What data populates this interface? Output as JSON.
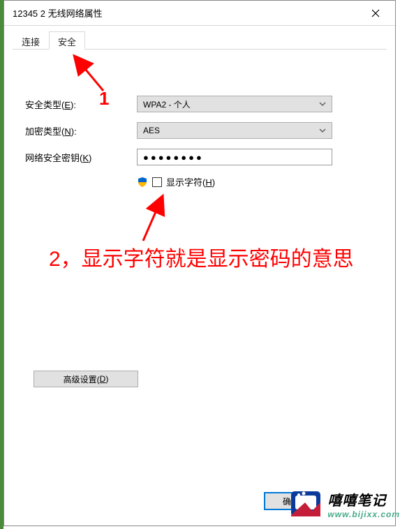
{
  "window": {
    "title": "12345 2 无线网络属性"
  },
  "tabs": {
    "connect": "连接",
    "security": "安全"
  },
  "fields": {
    "security_type_label_prefix": "安全类型(",
    "security_type_hotkey": "E",
    "security_type_label_suffix": "):",
    "security_type_value": "WPA2 - 个人",
    "encryption_type_label_prefix": "加密类型(",
    "encryption_type_hotkey": "N",
    "encryption_type_label_suffix": "):",
    "encryption_type_value": "AES",
    "network_key_label_prefix": "网络安全密钥(",
    "network_key_hotkey": "K",
    "network_key_label_suffix": ")",
    "network_key_value": "●●●●●●●●",
    "show_chars_label_prefix": "显示字符(",
    "show_chars_hotkey": "H",
    "show_chars_label_suffix": ")"
  },
  "buttons": {
    "advanced_prefix": "高级设置(",
    "advanced_hotkey": "D",
    "advanced_suffix": ")",
    "ok": "确定"
  },
  "annotations": {
    "n1": "1",
    "n2": "2，显示字符就是显示密码的意思"
  },
  "watermark": {
    "cn": "嘻嘻笔记",
    "url": "www.bijixx.com"
  }
}
